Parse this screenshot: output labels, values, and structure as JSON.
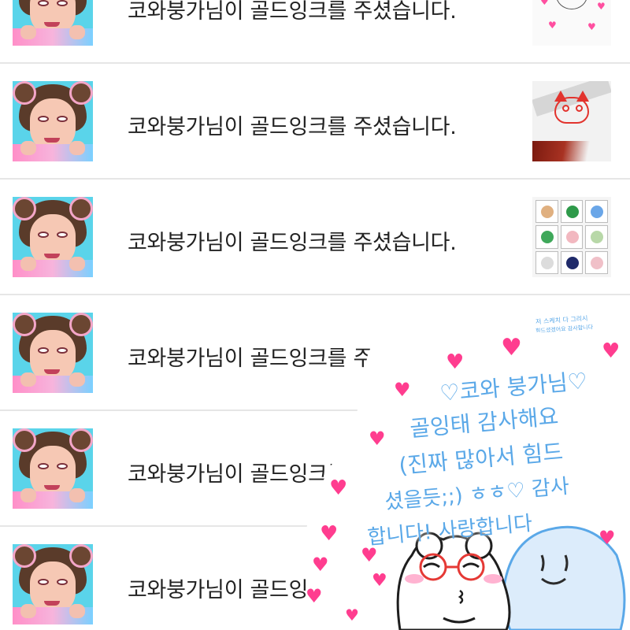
{
  "message_text": "코와붕가님이 골드잉크를 주셨습니다.",
  "rows": [
    {
      "message": "코와붕가님이 골드잉크를 주셨습니다.",
      "thumb": "sketch-hearts"
    },
    {
      "message": "코와붕가님이 골드잉크를 주셨습니다.",
      "thumb": "red-cat-drawing"
    },
    {
      "message": "코와붕가님이 골드잉크를 주셨습니다.",
      "thumb": "character-grid"
    },
    {
      "message": "코와붕가님이 골드잉크를 주셨습니다.",
      "thumb": "handwritten-note"
    },
    {
      "message": "코와붕가님이 골드잉크를 주셨습니다.",
      "thumb": "none-visible"
    },
    {
      "message": "코와붕가님이 골드잉크를 주셨습니다.",
      "thumb": "none-visible"
    }
  ],
  "overlay_note": {
    "lines": [
      "♡코와 붕가님♡",
      "골잉태 감사해요",
      "(진짜 많아서 힘드",
      "셨을듯;;) ㅎㅎ♡ 감사",
      "합니다! 사랑합니다"
    ],
    "tiny_note_lines": [
      "저 스케치 다 그리시",
      "힘드셨겠어요 감사합니다"
    ]
  },
  "colors": {
    "text": "#222222",
    "divider": "#e6e6e6",
    "heart": "#ff3d8f",
    "handwriting": "#5aa8e8",
    "avatar_bg": "#5ad4ea"
  }
}
